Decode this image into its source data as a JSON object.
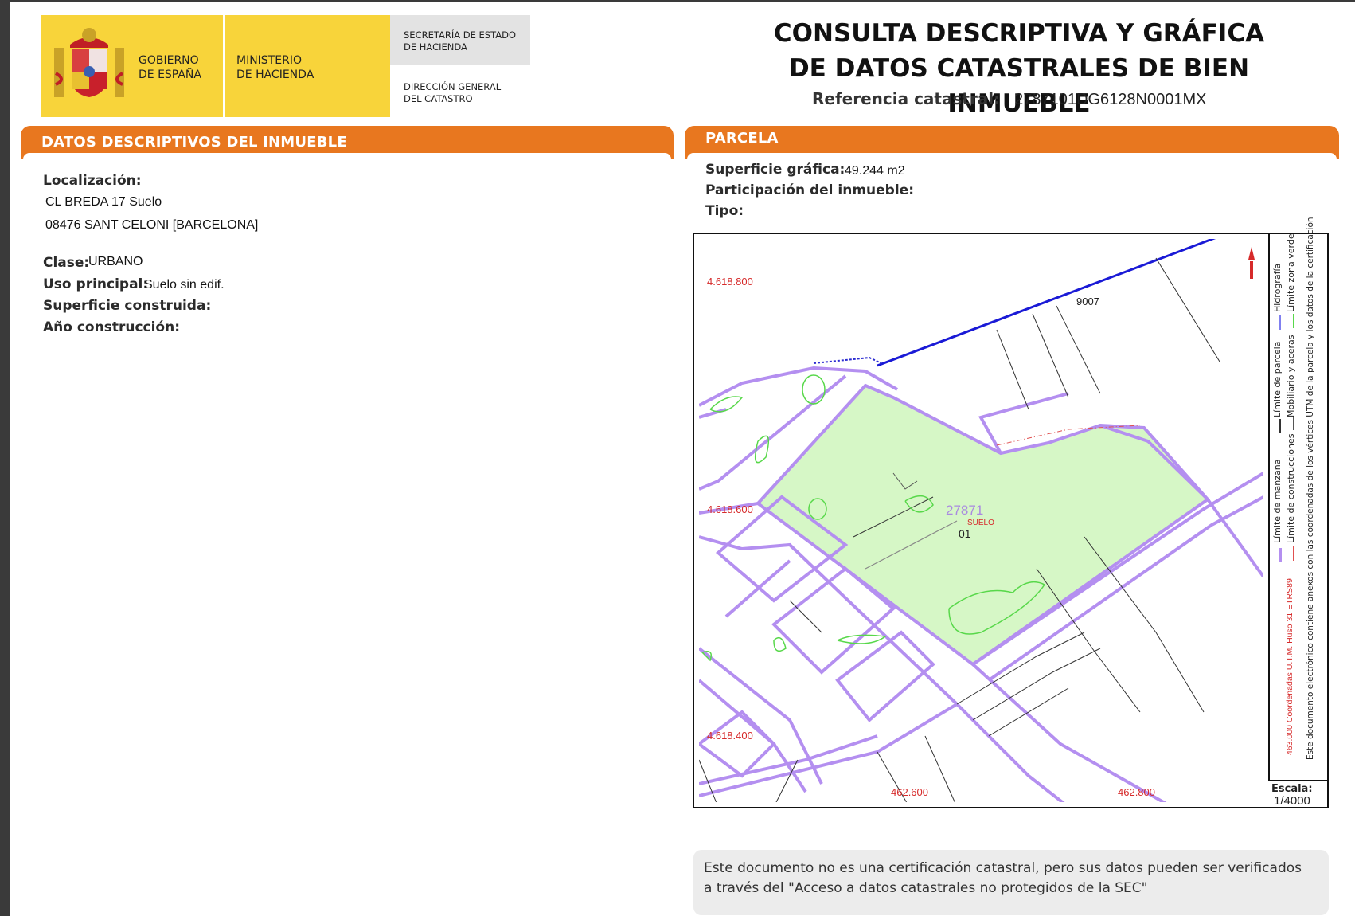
{
  "header": {
    "gov_line1": "GOBIERNO",
    "gov_line2": "DE ESPAÑA",
    "min_line1": "MINISTERIO",
    "min_line2": "DE HACIENDA",
    "sec_line1": "SECRETARÍA DE ESTADO",
    "sec_line2": "DE HACIENDA",
    "dir_line1": "DIRECCIÓN GENERAL",
    "dir_line2": "DEL CATASTRO",
    "title_line1": "CONSULTA DESCRIPTIVA Y GRÁFICA",
    "title_line2": "DE DATOS CATASTRALES DE BIEN INMUEBLE",
    "ref_label": "Referencia catastral:",
    "ref_value": "2787101DG6128N0001MX"
  },
  "descriptive": {
    "section_title": "DATOS DESCRIPTIVOS DEL INMUEBLE",
    "localizacion_label": "Localización:",
    "address_line1": "CL BREDA 17 Suelo",
    "address_line2": "08476 SANT CELONI [BARCELONA]",
    "clase_label": "Clase:",
    "clase_value": "URBANO",
    "uso_label": "Uso principal:",
    "uso_value": "Suelo sin edif.",
    "superficie_label": "Superficie construida:",
    "anio_label": "Año construcción:"
  },
  "parcela": {
    "section_title": "PARCELA",
    "superficie_label": "Superficie gráfica:",
    "superficie_value": "49.244 m2",
    "participacion_label": "Participación del inmueble:",
    "tipo_label": "Tipo:"
  },
  "map": {
    "y_labels": [
      "4.618.800",
      "4.618.600",
      "4.618.400"
    ],
    "x_labels": [
      "462.600",
      "462.800"
    ],
    "parcel_number": "27871",
    "parcel_use": "SUELO",
    "parcel_sub": "01",
    "road_label": "9007",
    "coord_note": "463.000 Coordenadas U.T.M. Huso 31 ETRS89",
    "legend_manzana": "Límite de manzana",
    "legend_parcela": "Límite de parcela",
    "legend_hidrografia": "Hidrografía",
    "legend_construcciones": "Límite de construcciones",
    "legend_mobiliario": "Mobiliario y aceras",
    "legend_zona_verde": "Límite zona verde",
    "legend_note": "Este documento electrónico contiene anexos con las coordenadas de los vértices UTM de la parcela y los datos de la certificación",
    "escala_label": "Escala:",
    "escala_value": "1/4000",
    "colors": {
      "parcel_fill": "#d6f7c6",
      "block_line": "#b48ff0",
      "hydro_line": "#1a1ad6",
      "label_red": "#d62a2a",
      "green_line": "#58d84a"
    }
  },
  "notice": {
    "text": "Este documento no es una certificación catastral, pero sus datos pueden ser verificados a través del \"Acceso a datos catastrales no protegidos de la SEC\""
  }
}
